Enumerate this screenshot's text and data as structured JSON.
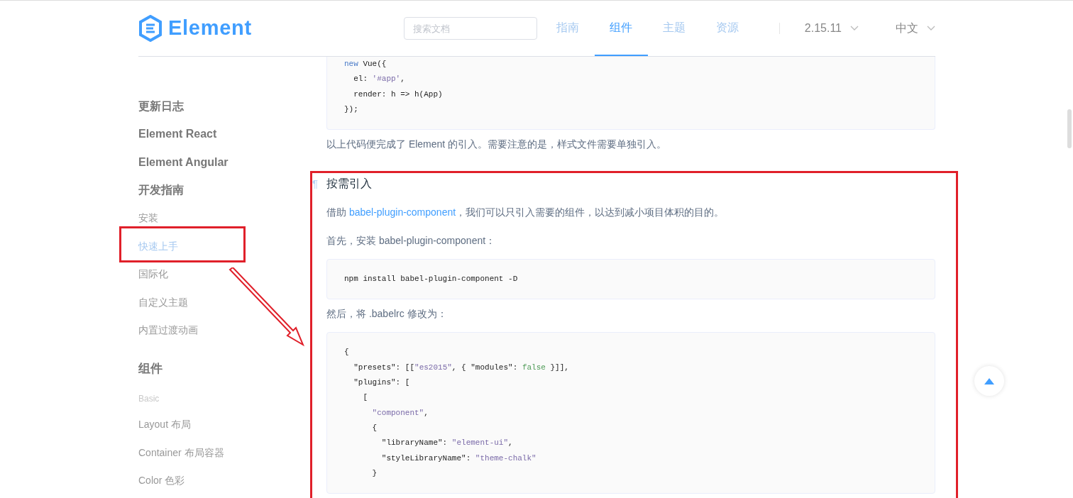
{
  "header": {
    "logo": "Element",
    "search": {
      "placeholder": "搜索文档"
    },
    "nav": [
      {
        "label": "指南",
        "selected": false
      },
      {
        "label": "组件",
        "selected": true
      },
      {
        "label": "主题",
        "selected": false
      },
      {
        "label": "资源",
        "selected": false
      }
    ],
    "version": "2.15.11",
    "language": "中文"
  },
  "sidebar": {
    "items": [
      {
        "kind": "group",
        "label": "更新日志"
      },
      {
        "kind": "group",
        "label": "Element React"
      },
      {
        "kind": "group",
        "label": "Element Angular"
      },
      {
        "kind": "group",
        "label": "开发指南"
      },
      {
        "kind": "link",
        "label": "安装",
        "selected": false
      },
      {
        "kind": "link",
        "label": "快速上手",
        "selected": true
      },
      {
        "kind": "link",
        "label": "国际化",
        "selected": false
      },
      {
        "kind": "link",
        "label": "自定义主题",
        "selected": false
      },
      {
        "kind": "link",
        "label": "内置过渡动画",
        "selected": false
      },
      {
        "kind": "section",
        "label": "组件"
      },
      {
        "kind": "category",
        "label": "Basic"
      },
      {
        "kind": "link",
        "label": "Layout 布局",
        "selected": false
      },
      {
        "kind": "link",
        "label": "Container 布局容器",
        "selected": false
      },
      {
        "kind": "link",
        "label": "Color 色彩",
        "selected": false
      }
    ]
  },
  "content": [
    {
      "kind": "code",
      "cut_top": true,
      "lines": [
        [
          {
            "kind": "keyword",
            "s": "new"
          },
          {
            "kind": "plain",
            "s": " Vue({"
          }
        ],
        [
          {
            "kind": "plain",
            "s": "  el: "
          },
          {
            "kind": "string",
            "s": "'#app'"
          },
          {
            "kind": "plain",
            "s": ","
          }
        ],
        [
          {
            "kind": "plain",
            "s": "  render: h => h(App)"
          }
        ],
        [
          {
            "kind": "plain",
            "s": "});"
          }
        ]
      ]
    },
    {
      "kind": "paragraph",
      "text": "以上代码便完成了 Element 的引入。需要注意的是，样式文件需要单独引入。"
    },
    {
      "kind": "heading",
      "anchor": "¶",
      "text": "按需引入"
    },
    {
      "kind": "paragraph",
      "before": "借助 ",
      "link": "babel-plugin-component",
      "after": "，我们可以只引入需要的组件，以达到减小项目体积的目的。"
    },
    {
      "kind": "paragraph",
      "text": "首先，安装 babel-plugin-component："
    },
    {
      "kind": "code",
      "cut_top": false,
      "lines": [
        [
          {
            "kind": "plain",
            "s": "npm install babel-plugin-component -D"
          }
        ]
      ]
    },
    {
      "kind": "paragraph",
      "text": "然后，将 .babelrc 修改为："
    },
    {
      "kind": "code",
      "cut_top": false,
      "lines": [
        [
          {
            "kind": "plain",
            "s": "{"
          }
        ],
        [
          {
            "kind": "plain",
            "s": "  \"presets\": [["
          },
          {
            "kind": "string",
            "s": "\"es2015\""
          },
          {
            "kind": "plain",
            "s": ", { \"modules\": "
          },
          {
            "kind": "boolean",
            "s": "false"
          },
          {
            "kind": "plain",
            "s": " }]],"
          }
        ],
        [
          {
            "kind": "plain",
            "s": "  \"plugins\": ["
          }
        ],
        [
          {
            "kind": "plain",
            "s": "    ["
          }
        ],
        [
          {
            "kind": "string",
            "s": "      \"component\""
          },
          {
            "kind": "plain",
            "s": ","
          }
        ],
        [
          {
            "kind": "plain",
            "s": "      {"
          }
        ],
        [
          {
            "kind": "plain",
            "s": "        \"libraryName\": "
          },
          {
            "kind": "string",
            "s": "\"element-ui\""
          },
          {
            "kind": "plain",
            "s": ","
          }
        ],
        [
          {
            "kind": "plain",
            "s": "        \"styleLibraryName\": "
          },
          {
            "kind": "string",
            "s": "\"theme-chalk\""
          }
        ],
        [
          {
            "kind": "plain",
            "s": "      }"
          }
        ]
      ]
    }
  ]
}
